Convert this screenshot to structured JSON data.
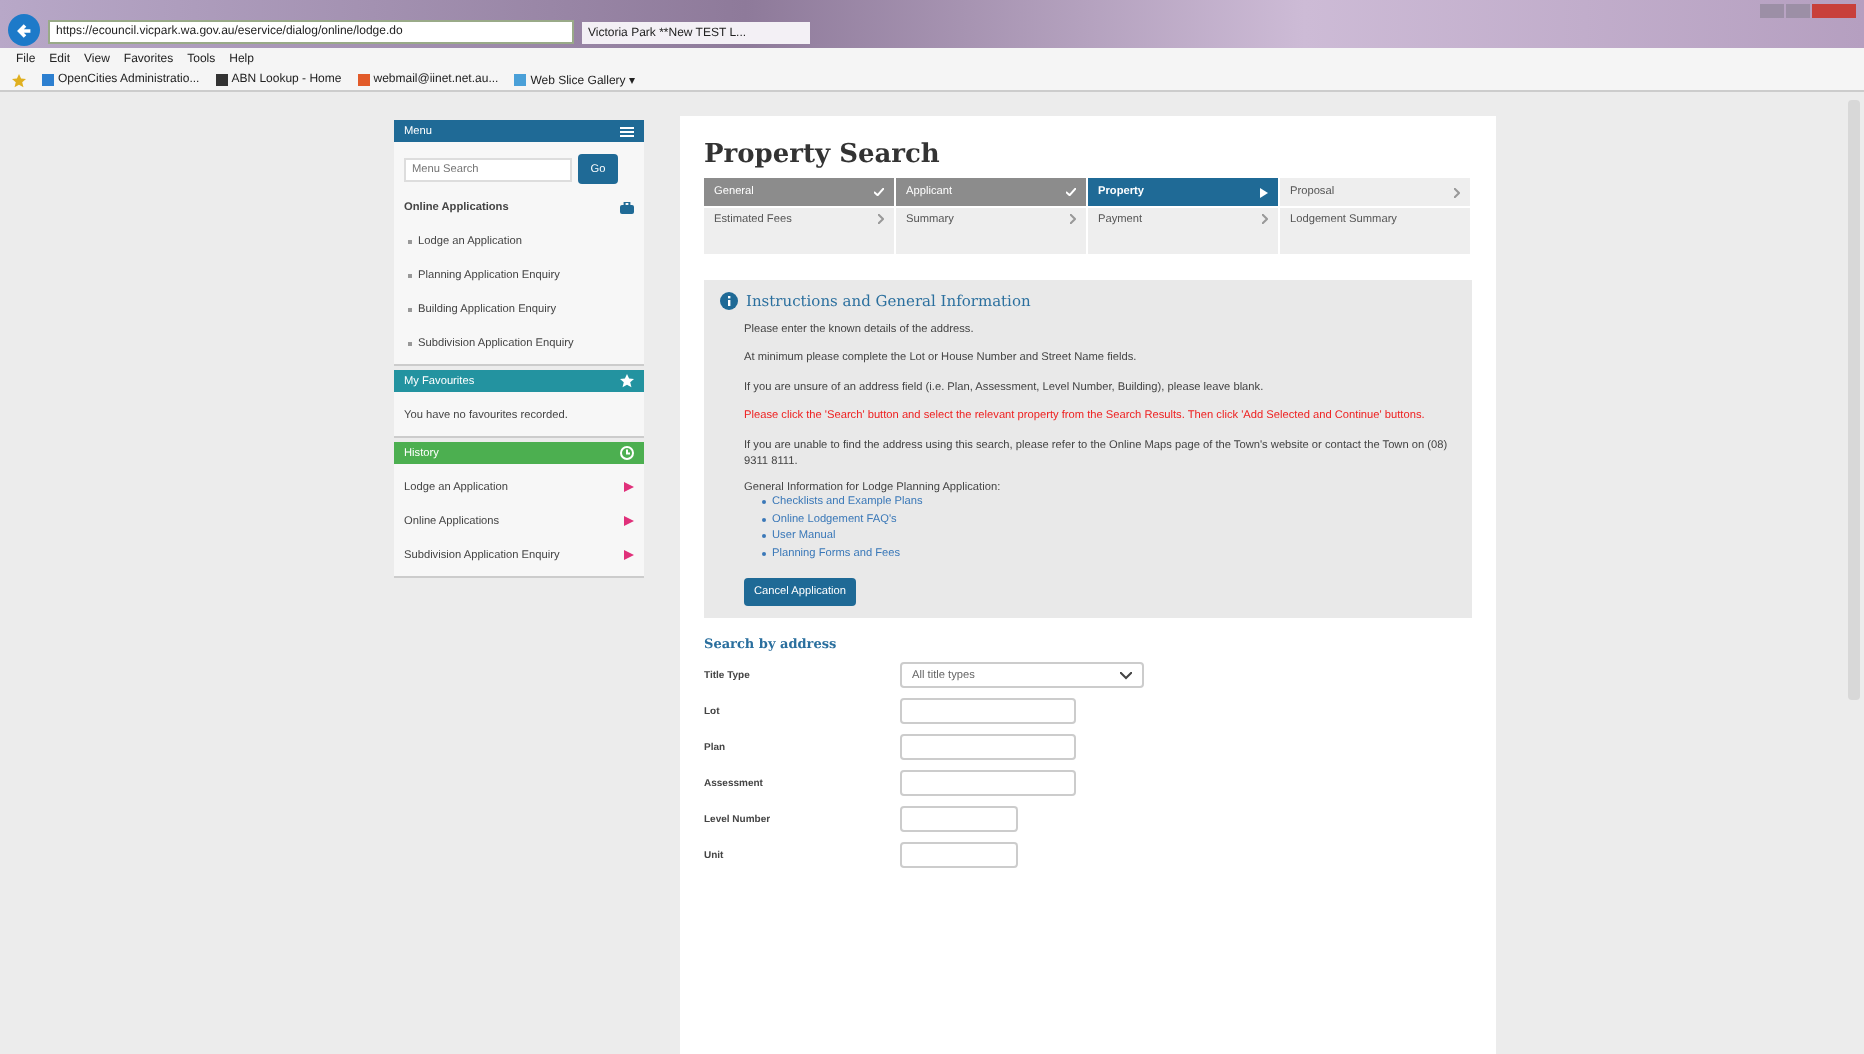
{
  "browser": {
    "address": "https://ecouncil.vicpark.wa.gov.au/eservice/dialog/online/lodge.do",
    "tab_title": "Victoria Park **New TEST L...",
    "menu": [
      "File",
      "Edit",
      "View",
      "Favorites",
      "Tools",
      "Help"
    ],
    "favorites": [
      "OpenCities Administratio...",
      "ABN Lookup - Home",
      "webmail@iinet.net.au...",
      "Web Slice Gallery ▾"
    ]
  },
  "sidebar": {
    "menu_title": "Menu",
    "search": {
      "placeholder": "Menu Search",
      "button": "Go"
    },
    "section_title": "Online Applications",
    "items": [
      "Lodge an Application",
      "Planning Application Enquiry",
      "Building Application Enquiry",
      "Subdivision Application Enquiry"
    ],
    "favourites_title": "My Favourites",
    "favourites_empty": "You have no favourites recorded.",
    "history_title": "History",
    "history": [
      "Lodge an Application",
      "Online Applications",
      "Subdivision Application Enquiry"
    ]
  },
  "page": {
    "title": "Property Search",
    "steps": [
      {
        "label": "General",
        "kind": "complete",
        "selected": false
      },
      {
        "label": "Applicant",
        "kind": "complete",
        "selected": false
      },
      {
        "label": "Property",
        "kind": "current",
        "selected": true
      },
      {
        "label": "Proposal",
        "kind": "pending",
        "selected": false
      },
      {
        "label": "Estimated Fees",
        "kind": "pending",
        "selected": false
      },
      {
        "label": "Summary",
        "kind": "pending",
        "selected": false
      },
      {
        "label": "Payment",
        "kind": "pending",
        "selected": false
      },
      {
        "label": "Lodgement Summary",
        "kind": "pending",
        "selected": false
      }
    ],
    "info": {
      "title": "Instructions and General Information",
      "paragraphs": [
        {
          "text": "Please enter the known details of the address.",
          "kind": "normal"
        },
        {
          "text": "At minimum please complete the Lot or House Number and Street Name fields.",
          "kind": "normal"
        },
        {
          "text": "If you are unsure of an address field (i.e. Plan, Assessment, Level Number, Building), please leave blank.",
          "kind": "normal"
        },
        {
          "text": "Please click the 'Search' button and select the relevant property from the Search Results. Then click 'Add Selected and Continue' buttons.",
          "kind": "warning"
        },
        {
          "text": "If you are unable to find the address using this search, please refer to the Online Maps page of the Town's website or contact the Town on (08) 9311 8111.",
          "kind": "normal"
        }
      ],
      "links_intro": "General Information for Lodge Planning Application:",
      "links": [
        "Checklists and Example Plans",
        "Online Lodgement FAQ's",
        "User Manual",
        "Planning Forms and Fees"
      ],
      "cancel_button": "Cancel Application"
    },
    "search_title": "Search by address",
    "fields": [
      {
        "label": "Title Type",
        "kind": "select",
        "value": "All title types"
      },
      {
        "label": "Lot",
        "kind": "text"
      },
      {
        "label": "Plan",
        "kind": "text"
      },
      {
        "label": "Assessment",
        "kind": "text"
      },
      {
        "label": "Level Number",
        "kind": "short"
      },
      {
        "label": "Unit",
        "kind": "short"
      }
    ]
  }
}
